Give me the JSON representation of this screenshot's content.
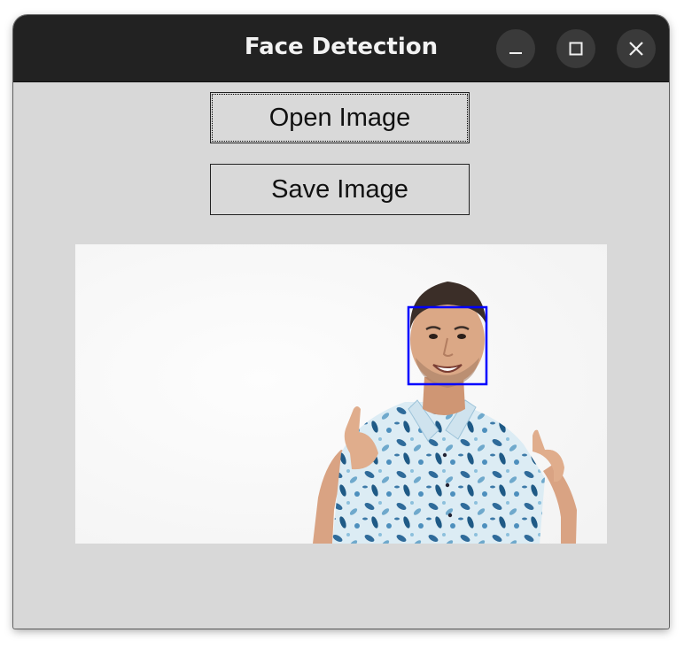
{
  "window": {
    "title": "Face Detection",
    "controls": {
      "minimize_icon": "minimize-icon",
      "maximize_icon": "maximize-icon",
      "close_icon": "close-icon"
    }
  },
  "toolbar": {
    "open_label": "Open Image",
    "save_label": "Save Image"
  },
  "image": {
    "description_icon": "photo",
    "detection_box_color": "#0000ff",
    "shirt_color": "#dfeef5",
    "shirt_pattern_color": "#2f6b9a"
  },
  "colors": {
    "titlebar": "#222222",
    "window_bg": "#d8d8d8",
    "button_border": "#222222"
  }
}
